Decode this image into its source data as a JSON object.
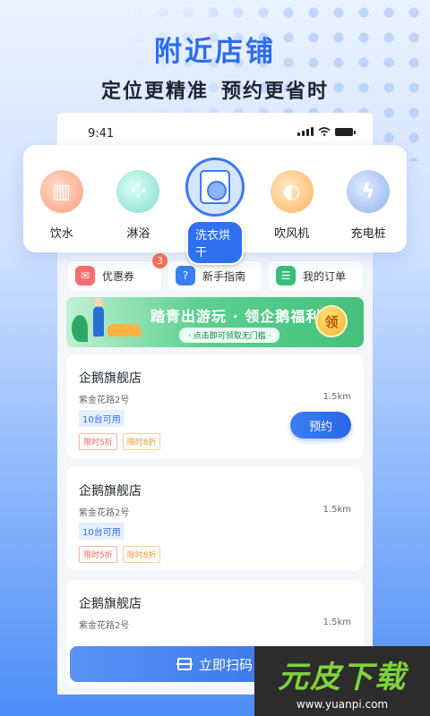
{
  "header": {
    "title": "附近店铺",
    "subtitle_left": "定位更精准",
    "subtitle_right": "预约更省时"
  },
  "status_bar": {
    "time": "9:41"
  },
  "categories": [
    {
      "label": "饮水",
      "icon": "water-icon",
      "active": false
    },
    {
      "label": "淋浴",
      "icon": "shower-icon",
      "active": false
    },
    {
      "label": "洗衣烘干",
      "icon": "washer-icon",
      "active": true
    },
    {
      "label": "吹风机",
      "icon": "hair-dryer-icon",
      "active": false
    },
    {
      "label": "充电桩",
      "icon": "charging-icon",
      "active": false
    }
  ],
  "quick_links": [
    {
      "label": "优惠券",
      "icon": "coupon-icon",
      "badge": "3",
      "color": "#ff6d6d"
    },
    {
      "label": "新手指南",
      "icon": "guide-icon",
      "color": "#3b7ef2"
    },
    {
      "label": "我的订单",
      "icon": "order-icon",
      "color": "#37c07a"
    }
  ],
  "banner": {
    "title": "踏青出游玩 · 领企鹅福利",
    "hint": "· 点击即可领取无门槛 ·",
    "badge": "领"
  },
  "stores": [
    {
      "name": "企鹅旗舰店",
      "address": "紫金花路2号",
      "distance": "1.5km",
      "available": "10台可用",
      "tags": [
        "限时5折",
        "限时8折"
      ],
      "book_label": "预约",
      "show_book": true
    },
    {
      "name": "企鹅旗舰店",
      "address": "紫金花路2号",
      "distance": "1.5km",
      "available": "10台可用",
      "tags": [
        "限时5折",
        "限时8折"
      ],
      "show_book": false
    },
    {
      "name": "企鹅旗舰店",
      "address": "紫金花路2号",
      "distance": "1.5km",
      "show_book": false
    }
  ],
  "scan_button": {
    "label": "立即扫码"
  },
  "watermark": {
    "title": "元皮下载",
    "url": "www.yuanpi.com"
  },
  "colors": {
    "primary": "#2f6ff0",
    "accent_green": "#44c07c",
    "badge_red": "#ff6f4d"
  }
}
